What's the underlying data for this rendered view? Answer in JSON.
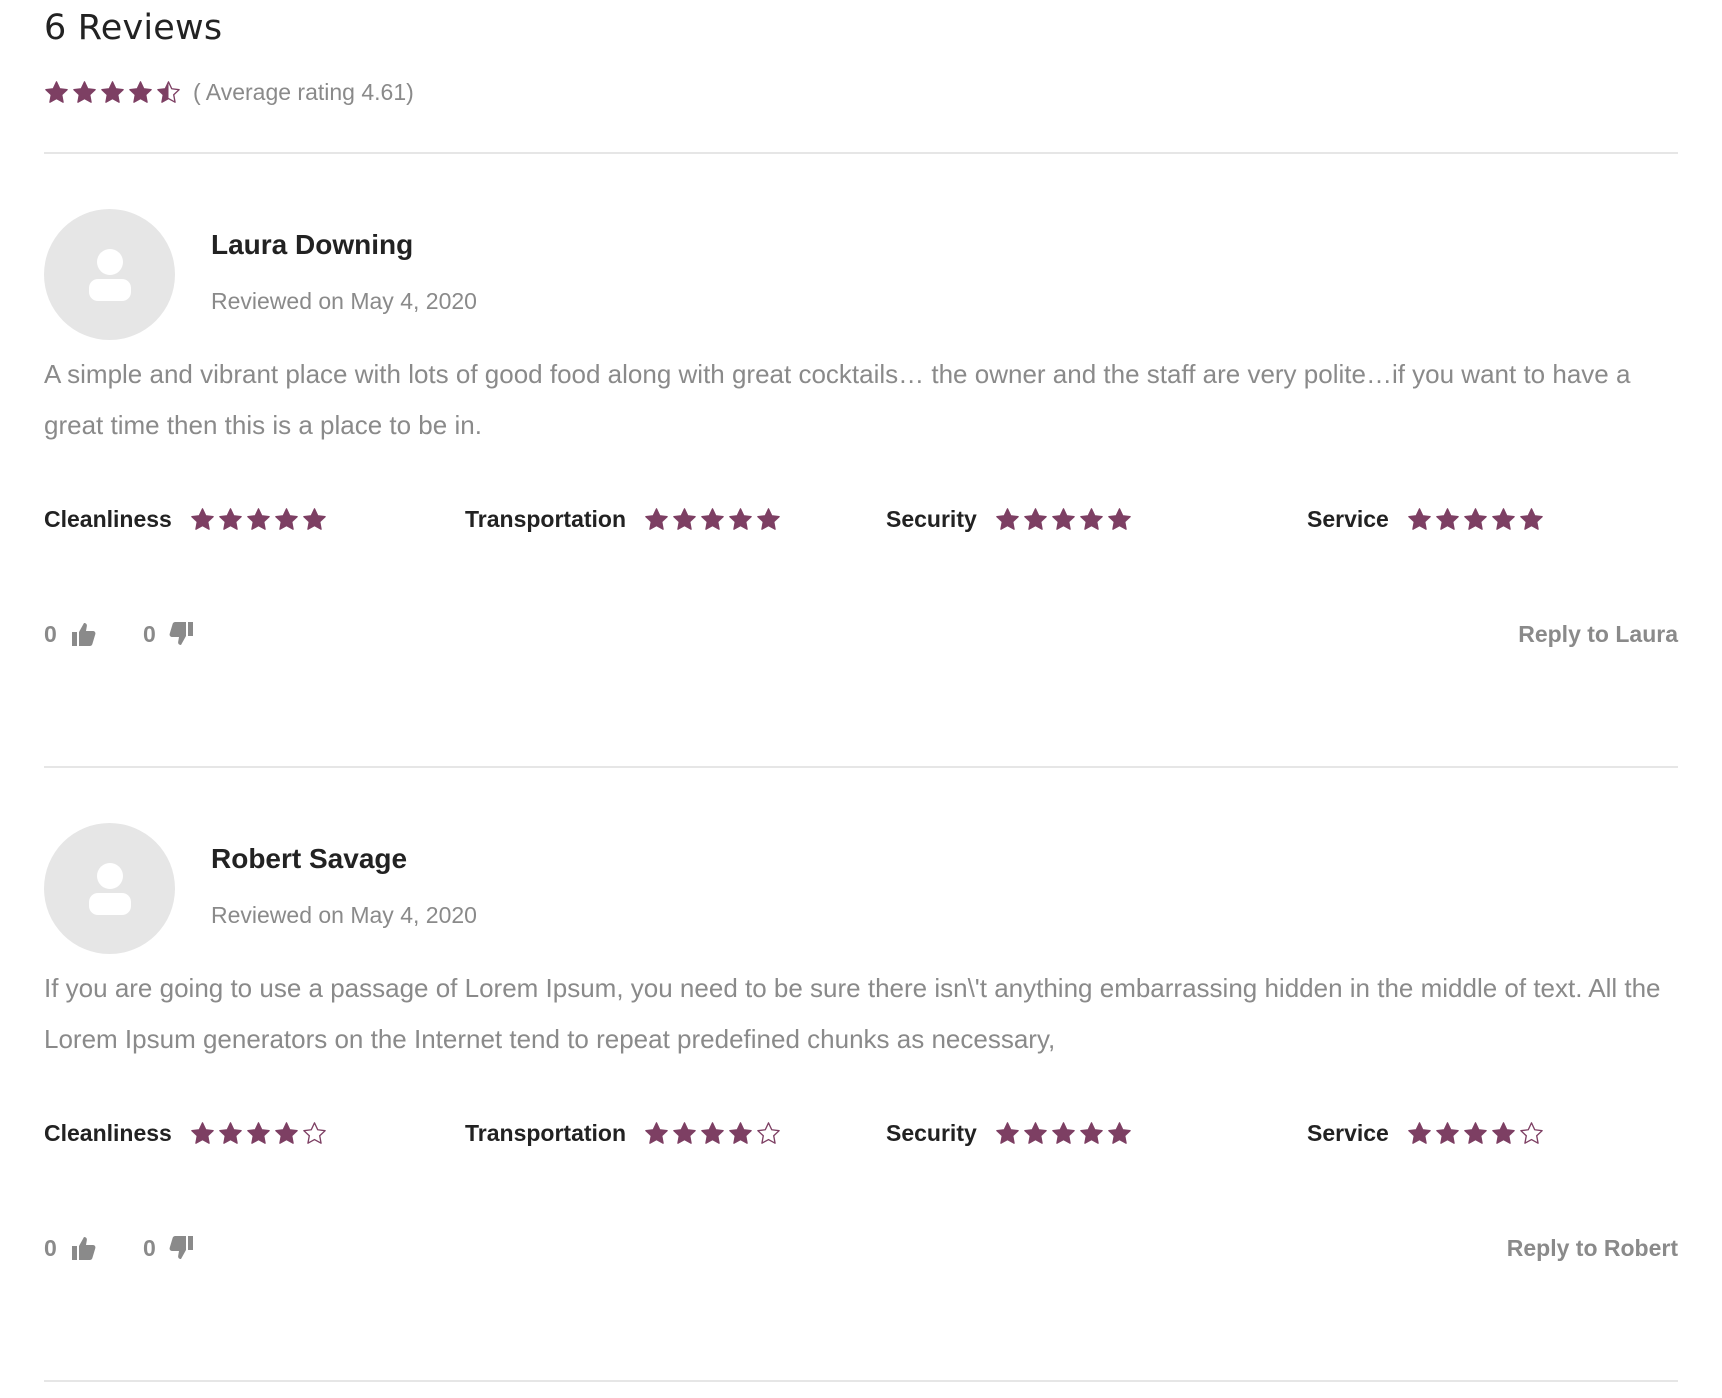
{
  "header": {
    "title": "6 Reviews",
    "average_label": "( Average rating 4.61)",
    "average_rating": 4.61,
    "star_color": "#7d3f63"
  },
  "reviews": [
    {
      "author": "Laura Downing",
      "date": "Reviewed on May 4, 2020",
      "text": "A simple and vibrant place with lots of good food along with great cocktails… the owner and the staff are very polite…if you want to have a great time then this is a place to be in.",
      "ratings": [
        {
          "label": "Cleanliness",
          "stars": 5
        },
        {
          "label": "Transportation",
          "stars": 5
        },
        {
          "label": "Security",
          "stars": 5
        },
        {
          "label": "Service",
          "stars": 5
        }
      ],
      "likes": "0",
      "dislikes": "0",
      "reply_label": "Reply to Laura"
    },
    {
      "author": "Robert Savage",
      "date": "Reviewed on May 4, 2020",
      "text": "If you are going to use a passage of Lorem Ipsum, you need to be sure there isn\\'t anything embarrassing hidden in the middle of text. All the Lorem Ipsum generators on the Internet tend to repeat predefined chunks as necessary,",
      "ratings": [
        {
          "label": "Cleanliness",
          "stars": 4
        },
        {
          "label": "Transportation",
          "stars": 4
        },
        {
          "label": "Security",
          "stars": 5
        },
        {
          "label": "Service",
          "stars": 4
        }
      ],
      "likes": "0",
      "dislikes": "0",
      "reply_label": "Reply to Robert"
    }
  ]
}
